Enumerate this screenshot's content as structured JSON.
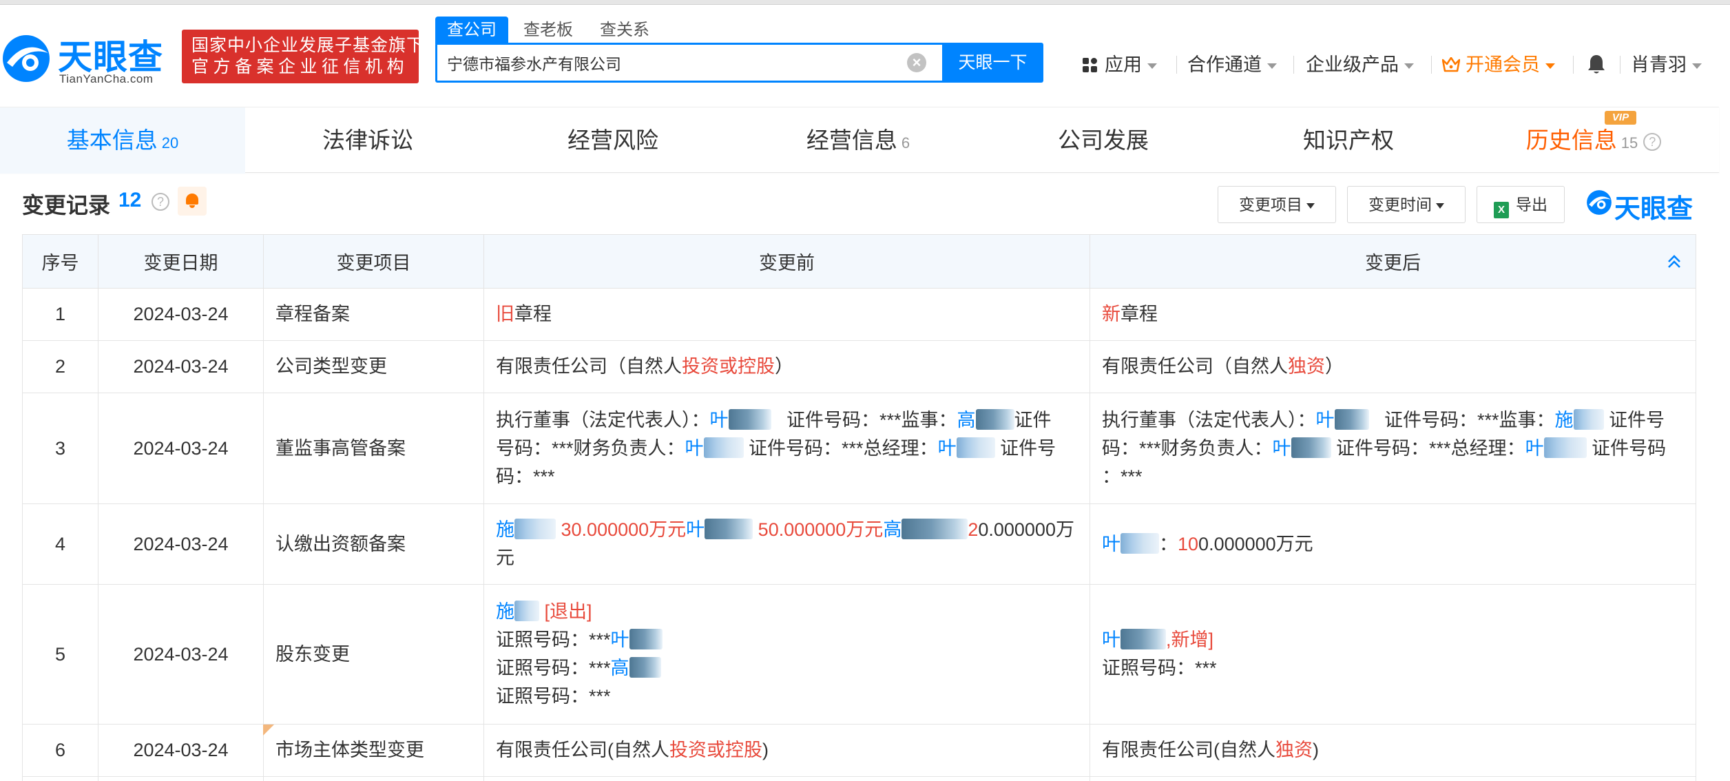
{
  "header": {
    "logo_text": "天眼查",
    "logo_domain": "TianYanCha.com",
    "gov_badge_line1": "国家中小企业发展子基金旗下",
    "gov_badge_line2": "官方备案企业征信机构",
    "search_tabs": [
      "查公司",
      "查老板",
      "查关系"
    ],
    "search_value": "宁德市福参水产有限公司",
    "search_button": "天眼一下",
    "nav": {
      "apps": "应用",
      "cooperation": "合作通道",
      "enterprise": "企业级产品",
      "vip": "开通会员",
      "user": "肖青羽"
    }
  },
  "modules": [
    {
      "label": "基本信息",
      "count": "20"
    },
    {
      "label": "法律诉讼",
      "count": ""
    },
    {
      "label": "经营风险",
      "count": ""
    },
    {
      "label": "经营信息",
      "count": "6"
    },
    {
      "label": "公司发展",
      "count": ""
    },
    {
      "label": "知识产权",
      "count": ""
    },
    {
      "label": "历史信息",
      "count": "15"
    }
  ],
  "vip_tag": "VIP",
  "section": {
    "title": "变更记录",
    "count": "12",
    "filter_item": "变更项目",
    "filter_time": "变更时间",
    "export": "导出",
    "mini_logo": "天眼查"
  },
  "table": {
    "headers": [
      "序号",
      "变更日期",
      "变更项目",
      "变更前",
      "变更后"
    ],
    "rows": [
      {
        "no": "1",
        "date": "2024-03-24",
        "item": "章程备案"
      },
      {
        "no": "2",
        "date": "2024-03-24",
        "item": "公司类型变更"
      },
      {
        "no": "3",
        "date": "2024-03-24",
        "item": "董监事高管备案"
      },
      {
        "no": "4",
        "date": "2024-03-24",
        "item": "认缴出资额备案"
      },
      {
        "no": "5",
        "date": "2024-03-24",
        "item": "股东变更"
      },
      {
        "no": "6",
        "date": "2024-03-24",
        "item": "市场主体类型变更"
      }
    ],
    "r1": {
      "before_mark": "旧",
      "before_text": "章程",
      "after_mark": "新",
      "after_text": "章程"
    },
    "r2": {
      "before_prefix": "有限责任公司（自然人",
      "before_hl": "投资或控股",
      "before_suffix": "）",
      "after_prefix": "有限责任公司（自然人",
      "after_hl": "独资",
      "after_suffix": "）"
    },
    "r3": {
      "b_legal": "执行董事（法定代表人）：",
      "b_ye1": "叶",
      "b_id1": "证件号码：***监事：",
      "b_gao": "高",
      "b_id2a": "证件",
      "b_id2b": "号码：***财务负责人：",
      "b_ye2": "叶",
      "b_id3": "证件号码：***总经理：",
      "b_ye3": "叶",
      "b_id4a": "证件号",
      "b_id4b": "码：***",
      "a_legal": "执行董事（法定代表人）：",
      "a_ye1": "叶",
      "a_id1": "证件号码：***监事：",
      "a_shi": "施",
      "a_id2a": "证件号",
      "a_id2b": "码：***财务负责人：",
      "a_ye2": "叶",
      "a_id3": "证件号码：***总经理：",
      "a_ye3": "叶",
      "a_id4a": "证件号码",
      "a_id4b": "：***"
    },
    "r4": {
      "b_shi": "施",
      "b_amt1": "30.000000万元",
      "b_ye": "叶",
      "b_amt2": "50.000000万元",
      "b_gao": "高",
      "b_amt3_red": "2",
      "b_amt3_rest": "0.000000万",
      "b_amt3_tail": "元",
      "a_ye": "叶",
      "a_colon": "：",
      "a_amt_red": "10",
      "a_amt_rest": "0.000000万元"
    },
    "r5": {
      "b_shi": "施",
      "b_exit": "[退出]",
      "b_cert": "证照号码：***",
      "b_ye": "叶",
      "b_gao": "高",
      "a_ye": "叶",
      "a_new": ",新增]",
      "a_cert": "证照号码：***"
    },
    "r6": {
      "before_prefix": "有限责任公司(自然人",
      "before_hl": "投资或控股",
      "before_suffix": ")",
      "after_prefix": "有限责任公司(自然人",
      "after_hl": "独资",
      "after_suffix": ")"
    }
  },
  "colors": {
    "brand_blue": "#0084ff",
    "highlight_red": "#e84a3c",
    "badge_red": "#d9312c",
    "vip_orange": "#ff7a00"
  }
}
